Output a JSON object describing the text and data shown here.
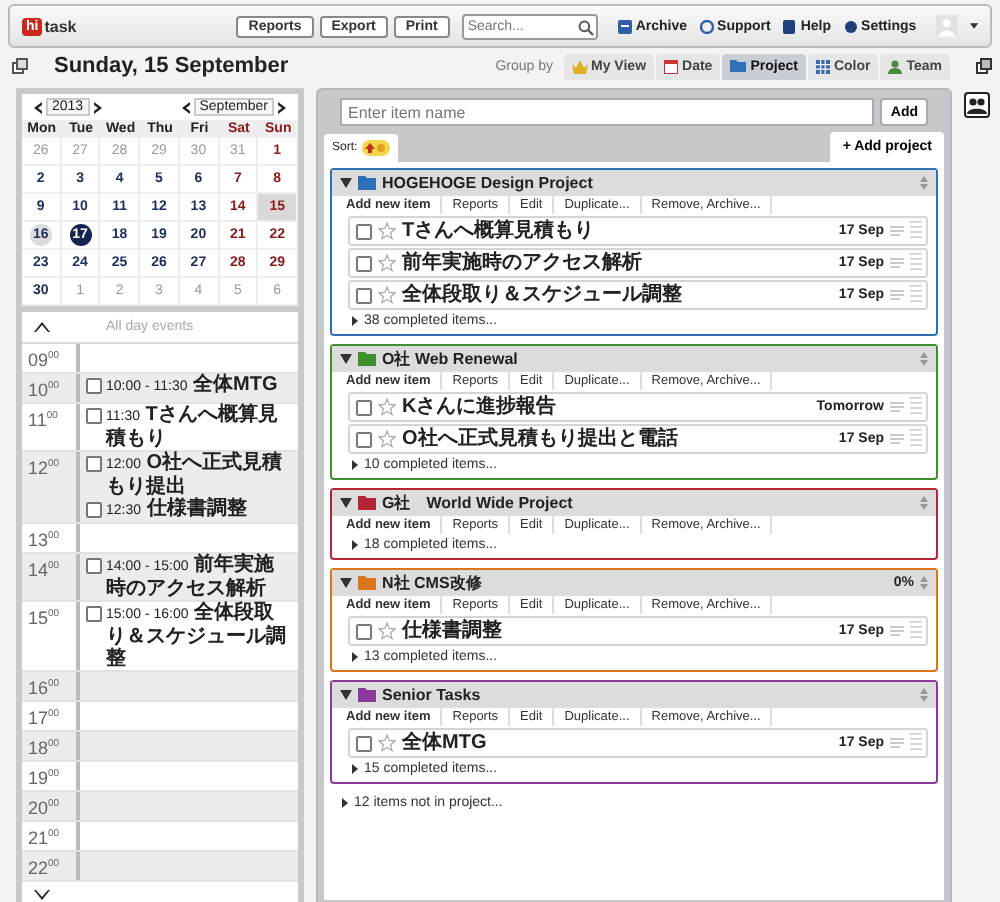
{
  "header": {
    "logo_mark": "hi",
    "logo_text": "task",
    "buttons": [
      "Reports",
      "Export",
      "Print"
    ],
    "search": {
      "placeholder": "Search..."
    },
    "links": [
      "Archive",
      "Support",
      "Help",
      "Settings"
    ]
  },
  "date_title": "Sunday, 15 September",
  "group_by": {
    "label": "Group by",
    "tabs": [
      {
        "label": "My View",
        "selected": false
      },
      {
        "label": "Date",
        "selected": false
      },
      {
        "label": "Project",
        "selected": true
      },
      {
        "label": "Color",
        "selected": false
      },
      {
        "label": "Team",
        "selected": false
      }
    ]
  },
  "calendar": {
    "year": "2013",
    "month": "September",
    "weekdays": [
      {
        "label": "Mon",
        "weekend": false
      },
      {
        "label": "Tue",
        "weekend": false
      },
      {
        "label": "Wed",
        "weekend": false
      },
      {
        "label": "Thu",
        "weekend": false
      },
      {
        "label": "Fri",
        "weekend": false
      },
      {
        "label": "Sat",
        "weekend": true
      },
      {
        "label": "Sun",
        "weekend": true
      }
    ],
    "weeks": [
      [
        {
          "label": "26",
          "muted": true,
          "selected": false,
          "today": false,
          "marked": false
        },
        {
          "label": "27",
          "muted": true,
          "selected": false,
          "today": false,
          "marked": false
        },
        {
          "label": "28",
          "muted": true,
          "selected": false,
          "today": false,
          "marked": false
        },
        {
          "label": "29",
          "muted": true,
          "selected": false,
          "today": false,
          "marked": false
        },
        {
          "label": "30",
          "muted": true,
          "selected": false,
          "today": false,
          "marked": false
        },
        {
          "label": "31",
          "muted": true,
          "selected": false,
          "today": false,
          "marked": false
        },
        {
          "label": "1",
          "muted": false,
          "selected": false,
          "today": false,
          "marked": false
        }
      ],
      [
        {
          "label": "2",
          "muted": false,
          "selected": false,
          "today": false,
          "marked": false
        },
        {
          "label": "3",
          "muted": false,
          "selected": false,
          "today": false,
          "marked": false
        },
        {
          "label": "4",
          "muted": false,
          "selected": false,
          "today": false,
          "marked": false
        },
        {
          "label": "5",
          "muted": false,
          "selected": false,
          "today": false,
          "marked": false
        },
        {
          "label": "6",
          "muted": false,
          "selected": false,
          "today": false,
          "marked": false
        },
        {
          "label": "7",
          "muted": false,
          "selected": false,
          "today": false,
          "marked": false
        },
        {
          "label": "8",
          "muted": false,
          "selected": false,
          "today": false,
          "marked": false
        }
      ],
      [
        {
          "label": "9",
          "muted": false,
          "selected": false,
          "today": false,
          "marked": false
        },
        {
          "label": "10",
          "muted": false,
          "selected": false,
          "today": false,
          "marked": false
        },
        {
          "label": "11",
          "muted": false,
          "selected": false,
          "today": false,
          "marked": false
        },
        {
          "label": "12",
          "muted": false,
          "selected": false,
          "today": false,
          "marked": false
        },
        {
          "label": "13",
          "muted": false,
          "selected": false,
          "today": false,
          "marked": false
        },
        {
          "label": "14",
          "muted": false,
          "selected": false,
          "today": false,
          "marked": false
        },
        {
          "label": "15",
          "muted": false,
          "selected": true,
          "today": false,
          "marked": false
        }
      ],
      [
        {
          "label": "16",
          "muted": false,
          "selected": false,
          "today": false,
          "marked": true
        },
        {
          "label": "17",
          "muted": false,
          "selected": false,
          "today": true,
          "marked": false
        },
        {
          "label": "18",
          "muted": false,
          "selected": false,
          "today": false,
          "marked": false
        },
        {
          "label": "19",
          "muted": false,
          "selected": false,
          "today": false,
          "marked": false
        },
        {
          "label": "20",
          "muted": false,
          "selected": false,
          "today": false,
          "marked": false
        },
        {
          "label": "21",
          "muted": false,
          "selected": false,
          "today": false,
          "marked": false
        },
        {
          "label": "22",
          "muted": false,
          "selected": false,
          "today": false,
          "marked": false
        }
      ],
      [
        {
          "label": "23",
          "muted": false,
          "selected": false,
          "today": false,
          "marked": false
        },
        {
          "label": "24",
          "muted": false,
          "selected": false,
          "today": false,
          "marked": false
        },
        {
          "label": "25",
          "muted": false,
          "selected": false,
          "today": false,
          "marked": false
        },
        {
          "label": "26",
          "muted": false,
          "selected": false,
          "today": false,
          "marked": false
        },
        {
          "label": "27",
          "muted": false,
          "selected": false,
          "today": false,
          "marked": false
        },
        {
          "label": "28",
          "muted": false,
          "selected": false,
          "today": false,
          "marked": false
        },
        {
          "label": "29",
          "muted": false,
          "selected": false,
          "today": false,
          "marked": false
        }
      ],
      [
        {
          "label": "30",
          "muted": false,
          "selected": false,
          "today": false,
          "marked": false
        },
        {
          "label": "1",
          "muted": true,
          "selected": false,
          "today": false,
          "marked": false
        },
        {
          "label": "2",
          "muted": true,
          "selected": false,
          "today": false,
          "marked": false
        },
        {
          "label": "3",
          "muted": true,
          "selected": false,
          "today": false,
          "marked": false
        },
        {
          "label": "4",
          "muted": true,
          "selected": false,
          "today": false,
          "marked": false
        },
        {
          "label": "5",
          "muted": true,
          "selected": false,
          "today": false,
          "marked": false
        },
        {
          "label": "6",
          "muted": true,
          "selected": false,
          "today": false,
          "marked": false
        }
      ]
    ]
  },
  "schedule": {
    "all_day_label": "All day events",
    "hours": [
      {
        "label": "09$^{00}$"
      },
      {
        "label": "10$^{00}$",
        "events": [
          {
            "time": "10:00 - 11:30",
            "title": "全体MTG",
            "checked": false
          }
        ]
      },
      {
        "label": "11$^{00}$",
        "events": [
          {
            "time": "11:30",
            "title": "Tさんへ概算見積もり",
            "checked": false
          }
        ]
      },
      {
        "label": "12$^{00}$",
        "events": [
          {
            "time": "12:00",
            "title": "O社へ正式見積もり提出",
            "checked": false
          },
          {
            "time": "12:30",
            "title": "仕様書調整",
            "checked": false
          }
        ]
      },
      {
        "label": "13$^{00}$"
      },
      {
        "label": "14$^{00}$",
        "events": [
          {
            "time": "14:00 - 15:00",
            "title": "前年実施時のアクセス解析",
            "checked": false
          }
        ]
      },
      {
        "label": "15$^{00}$",
        "events": [
          {
            "time": "15:00 - 16:00",
            "title": "全体段取り＆スケジュール調整",
            "checked": false
          }
        ]
      },
      {
        "label": "16$^{00}$"
      },
      {
        "label": "17$^{00}$"
      },
      {
        "label": "18$^{00}$"
      },
      {
        "label": "19$^{00}$"
      },
      {
        "label": "20$^{00}$"
      },
      {
        "label": "21$^{00}$"
      },
      {
        "label": "22$^{00}$"
      }
    ]
  },
  "composer": {
    "placeholder": "Enter item name",
    "button": "Add"
  },
  "sort_label": "Sort:",
  "add_project": "+ Add project",
  "projects": [
    {
      "name": "HOGEHOGE Design Project",
      "color": "#2f6fb5",
      "expanded": true,
      "actions": [
        "Add new item",
        "Reports",
        "Edit",
        "Duplicate...",
        "Remove, Archive..."
      ],
      "tasks": [
        {
          "title": "Tさんへ概算見積もり",
          "due": "17 Sep",
          "checked": false,
          "starred": false
        },
        {
          "title": "前年実施時のアクセス解析",
          "due": "17 Sep",
          "checked": false,
          "starred": false
        },
        {
          "title": "全体段取り＆スケジュール調整",
          "due": "17 Sep",
          "checked": false,
          "starred": false
        }
      ],
      "completed": "38 completed items..."
    },
    {
      "name": "O社 Web Renewal",
      "color": "#3f8f2f",
      "expanded": true,
      "actions": [
        "Add new item",
        "Reports",
        "Edit",
        "Duplicate...",
        "Remove, Archive..."
      ],
      "tasks": [
        {
          "title": "Kさんに進捗報告",
          "due": "Tomorrow",
          "checked": false,
          "starred": false
        },
        {
          "title": "O社へ正式見積もり提出と電話",
          "due": "17 Sep",
          "checked": false,
          "starred": false
        }
      ],
      "completed": "10 completed items..."
    },
    {
      "name": "G社　World Wide Project",
      "color": "#b5253a",
      "expanded": true,
      "actions": [
        "Add new item",
        "Reports",
        "Edit",
        "Duplicate...",
        "Remove, Archive..."
      ],
      "completed": "18 completed items..."
    },
    {
      "name": "N社 CMS改修",
      "color": "#d9751c",
      "expanded": true,
      "progress": "0%",
      "actions": [
        "Add new item",
        "Reports",
        "Edit",
        "Duplicate...",
        "Remove, Archive..."
      ],
      "tasks": [
        {
          "title": "仕様書調整",
          "due": "17 Sep",
          "checked": false,
          "starred": false
        }
      ],
      "completed": "13 completed items..."
    },
    {
      "name": "Senior Tasks",
      "color": "#8a3a9a",
      "expanded": true,
      "actions": [
        "Add new item",
        "Reports",
        "Edit",
        "Duplicate...",
        "Remove, Archive..."
      ],
      "tasks": [
        {
          "title": "全体MTG",
          "due": "17 Sep",
          "checked": false,
          "starred": false
        }
      ],
      "completed": "15 completed items..."
    }
  ],
  "not_in_project": "12 items not in project..."
}
